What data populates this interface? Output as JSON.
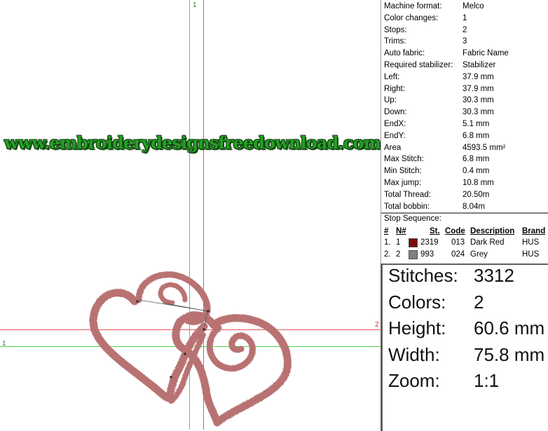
{
  "watermark": "www.embroiderydesignsfreedownload.com",
  "guides": {
    "top_label": "1",
    "left_label": "1",
    "right_label": "2"
  },
  "design": {
    "thread_color": "#b97272",
    "stitch_color": "#d9aeae"
  },
  "properties": [
    {
      "label": "Machine format:",
      "value": "Melco"
    },
    {
      "label": "Color changes:",
      "value": "1"
    },
    {
      "label": "Stops:",
      "value": "2"
    },
    {
      "label": "Trims:",
      "value": "3"
    },
    {
      "label": "Auto fabric:",
      "value": "Fabric Name"
    },
    {
      "label": "Required stabilizer:",
      "value": "Stabilizer"
    },
    {
      "label": "Left:",
      "value": "37.9 mm"
    },
    {
      "label": "Right:",
      "value": "37.9 mm"
    },
    {
      "label": "Up:",
      "value": "30.3 mm"
    },
    {
      "label": "Down:",
      "value": "30.3 mm"
    },
    {
      "label": "EndX:",
      "value": "5.1 mm"
    },
    {
      "label": "EndY:",
      "value": "6.8 mm"
    },
    {
      "label": "Area",
      "value": "4593.5 mm²"
    },
    {
      "label": "Max Stitch:",
      "value": "6.8 mm"
    },
    {
      "label": "Min Stitch:",
      "value": "0.4 mm"
    },
    {
      "label": "Max jump:",
      "value": "10.8 mm"
    },
    {
      "label": "Total Thread:",
      "value": "20.50m"
    },
    {
      "label": "Total bobbin:",
      "value": "8.04m"
    }
  ],
  "stop_sequence": {
    "title": "Stop Sequence:",
    "headers": [
      "#",
      "N#",
      "St.",
      "Code",
      "Description",
      "Brand"
    ],
    "rows": [
      {
        "index": "1.",
        "n": "1",
        "color": "#7a0a0a",
        "stitches": "2319",
        "code": "013",
        "description": "Dark Red",
        "brand": "HUS"
      },
      {
        "index": "2.",
        "n": "2",
        "color": "#808080",
        "stitches": "993",
        "code": "024",
        "description": "Grey",
        "brand": "HUS"
      }
    ]
  },
  "summary": [
    {
      "label": "Stitches:",
      "value": "3312"
    },
    {
      "label": "Colors:",
      "value": "2"
    },
    {
      "label": "Height:",
      "value": "60.6 mm"
    },
    {
      "label": "Width:",
      "value": "75.8 mm"
    },
    {
      "label": "Zoom:",
      "value": "1:1"
    }
  ]
}
